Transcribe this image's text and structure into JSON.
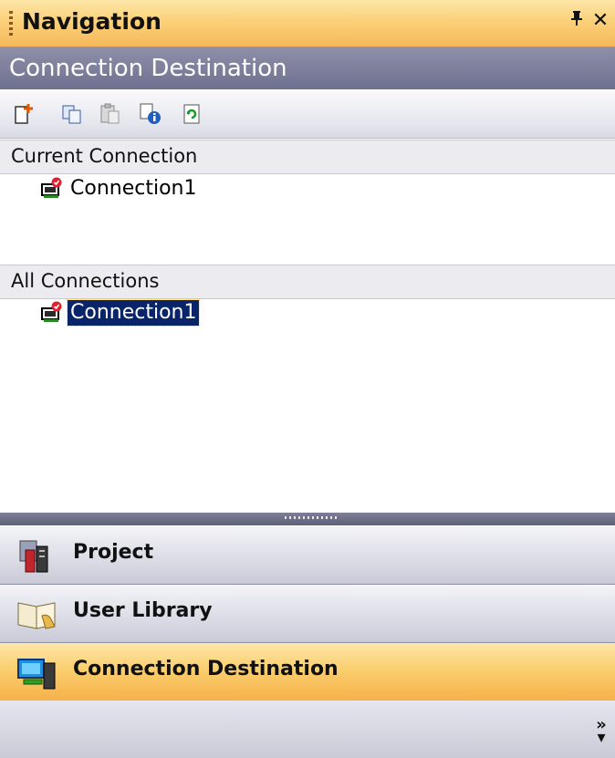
{
  "window": {
    "title": "Navigation",
    "pin_icon": "pin-icon",
    "close_icon": "close-icon"
  },
  "section": {
    "title": "Connection Destination"
  },
  "toolbar": {
    "tools": [
      {
        "name": "new-connection-icon"
      },
      {
        "name": "copy-icon"
      },
      {
        "name": "paste-icon"
      },
      {
        "name": "properties-icon"
      },
      {
        "name": "refresh-icon"
      }
    ]
  },
  "current_connection": {
    "header": "Current Connection",
    "items": [
      {
        "label": "Connection1",
        "icon": "connection-icon"
      }
    ]
  },
  "all_connections": {
    "header": "All Connections",
    "items": [
      {
        "label": "Connection1",
        "icon": "connection-icon",
        "selected": true
      }
    ]
  },
  "nav_buttons": [
    {
      "label": "Project",
      "icon": "project-icon",
      "active": false
    },
    {
      "label": "User Library",
      "icon": "user-library-icon",
      "active": false
    },
    {
      "label": "Connection Destination",
      "icon": "connection-destination-icon",
      "active": true
    }
  ],
  "footer": {
    "overflow_icon": "chevron-more-icon"
  }
}
